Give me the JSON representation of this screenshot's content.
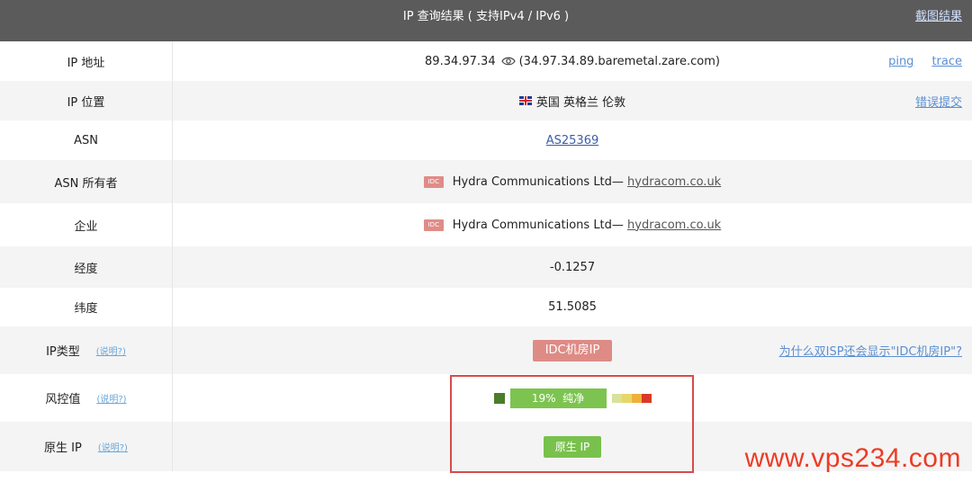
{
  "header": {
    "title": "IP 查询结果 ( 支持IPv4 / IPv6 )",
    "screenshot_link": "截图结果"
  },
  "rows": {
    "ip": {
      "label": "IP 地址",
      "ip": "89.34.97.34",
      "host": "(34.97.34.89.baremetal.zare.com)",
      "ping": "ping",
      "trace": "trace"
    },
    "location": {
      "label": "IP 位置",
      "value": "英国 英格兰 伦敦",
      "report": "错误提交"
    },
    "asn": {
      "label": "ASN",
      "value": "AS25369"
    },
    "asn_owner": {
      "label": "ASN 所有者",
      "badge": "IDC",
      "name": "Hydra Communications Ltd—",
      "site": "hydracom.co.uk"
    },
    "company": {
      "label": "企业",
      "badge": "IDC",
      "name": "Hydra Communications Ltd—",
      "site": "hydracom.co.uk"
    },
    "longitude": {
      "label": "经度",
      "value": "-0.1257"
    },
    "latitude": {
      "label": "纬度",
      "value": "51.5085"
    },
    "ip_type": {
      "label": "IP类型",
      "hint": "(说明?)",
      "value": "IDC机房IP",
      "why": "为什么双ISP还会显示\"IDC机房IP\"?"
    },
    "risk": {
      "label": "风控值",
      "hint": "(说明?)",
      "percent": "19%",
      "status": "纯净",
      "level": 0.19
    },
    "native": {
      "label": "原生 IP",
      "hint": "(说明?)",
      "value": "原生 IP"
    }
  },
  "watermark": "www.vps234.com",
  "colors": {
    "header": "#5b5b5b",
    "idc_red": "#de8b86",
    "risk_green": "#7cc44f",
    "highlight": "#d84a4a",
    "watermark": "#ee3b25"
  }
}
